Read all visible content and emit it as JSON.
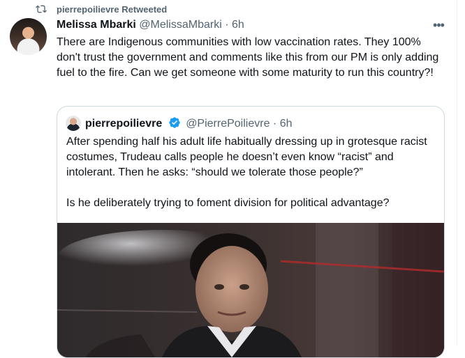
{
  "retweet_bar": {
    "icon": "retweet-icon",
    "text": "pierrepoilievre Retweeted"
  },
  "tweet": {
    "display_name": "Melissa Mbarki",
    "handle": "@MelissaMbarki",
    "separator": "·",
    "time": "6h",
    "more_icon": "more-icon",
    "more_label": "•••",
    "text": "There are Indigenous communities with low vaccination rates. They 100% don't trust the government and comments like this from our PM is only adding fuel to the fire. Can we get someone with some maturity to run this country?!"
  },
  "quoted_tweet": {
    "display_name": "pierrepoilievre",
    "verified_icon": "verified-badge-icon",
    "handle": "@PierrePoilievre",
    "separator": "·",
    "time": "6h",
    "paragraph_1": "After spending half his adult life habitually dressing up in grotesque racist costumes, Trudeau calls people he doesn’t even know “racist” and intolerant. Then he asks: “should we tolerate those people?”",
    "paragraph_2": "Is he deliberately trying to foment division for political advantage?"
  },
  "colors": {
    "primary_text": "#0f1419",
    "secondary_text": "#536471",
    "verified_blue": "#1d9bf0",
    "border": "#cfd9de"
  }
}
